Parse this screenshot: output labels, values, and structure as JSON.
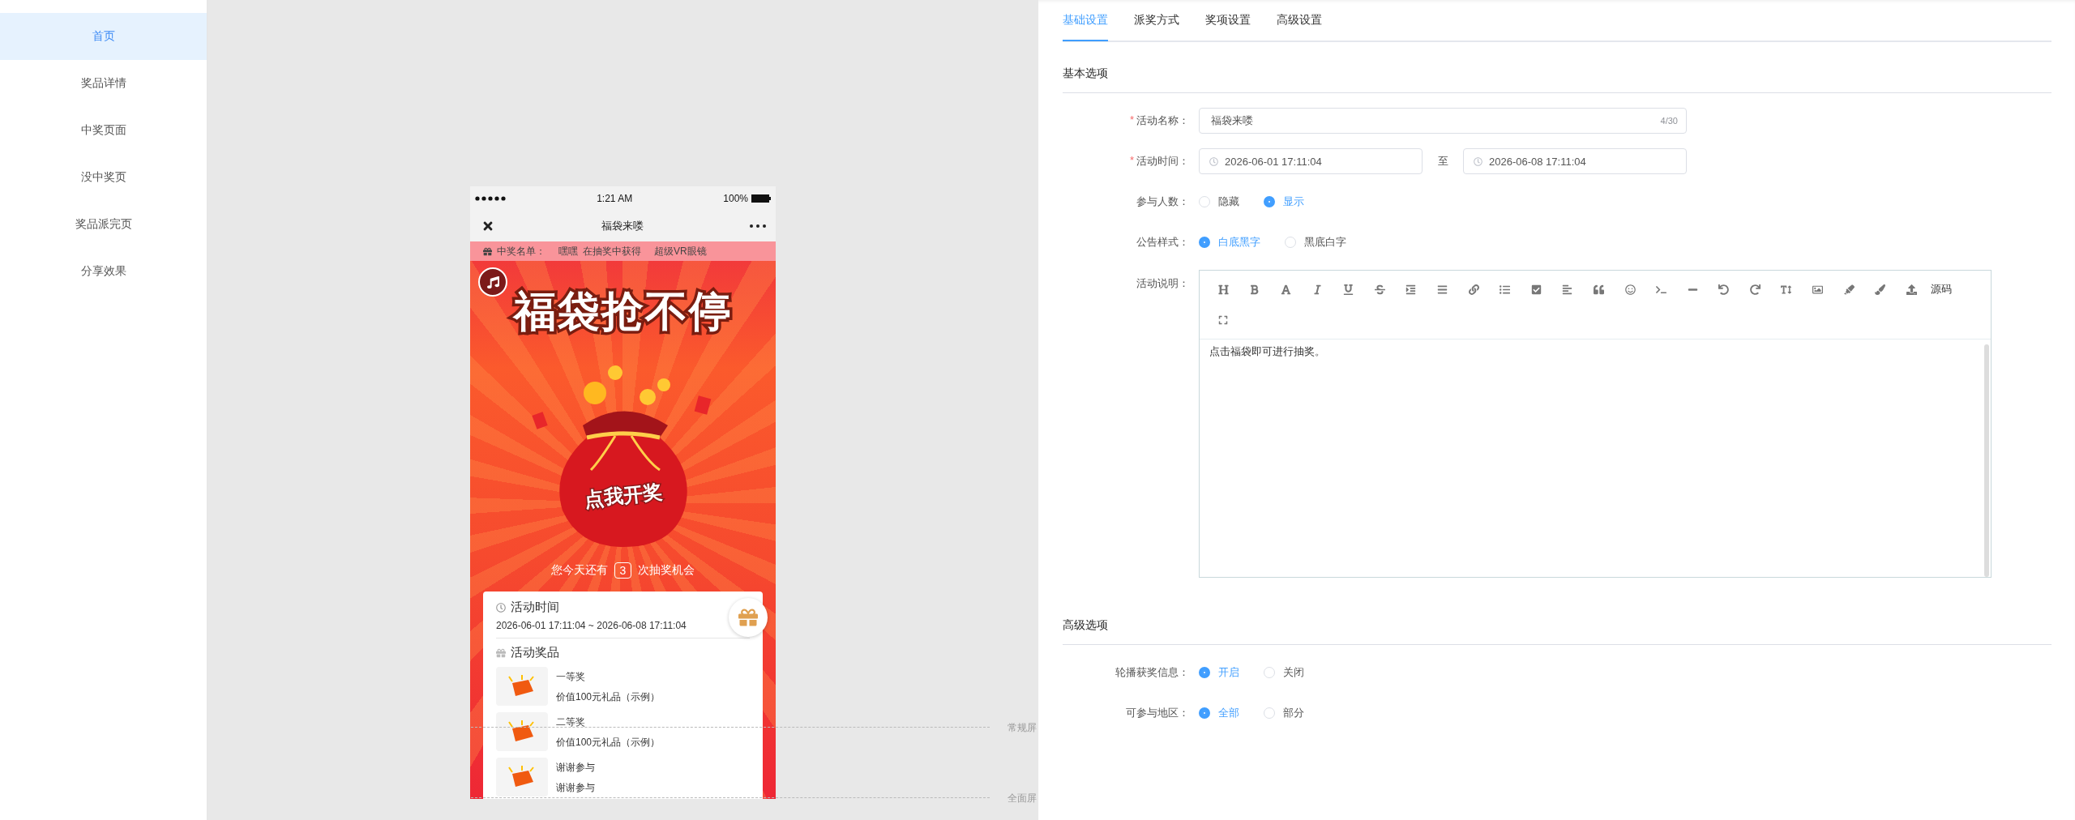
{
  "sidebar": {
    "items": [
      {
        "label": "首页",
        "selected": true
      },
      {
        "label": "奖品详情",
        "selected": false
      },
      {
        "label": "中奖页面",
        "selected": false
      },
      {
        "label": "没中奖页",
        "selected": false
      },
      {
        "label": "奖品派完页",
        "selected": false
      },
      {
        "label": "分享效果",
        "selected": false
      }
    ]
  },
  "phone": {
    "status_bar": {
      "time": "1:21 AM",
      "battery": "100%"
    },
    "nav_title": "福袋来喽",
    "marquee": {
      "label": "中奖名单：",
      "winner": "嘿嘿",
      "action": "在抽奖中获得",
      "prize": "超级VR眼镜"
    },
    "banner_title": "福袋抢不停",
    "bag_label": "点我开奖",
    "chances": {
      "before": "您今天还有",
      "count": "3",
      "after": "次抽奖机会"
    },
    "card": {
      "time_heading": "活动时间",
      "time_range": "2026-06-01 17:11:04 ~ 2026-06-08 17:11:04",
      "prizes_heading": "活动奖品",
      "prizes": [
        {
          "name": "一等奖",
          "desc": "价值100元礼品（示例）"
        },
        {
          "name": "二等奖",
          "desc": "价值100元礼品（示例）"
        },
        {
          "name": "谢谢参与",
          "desc": "谢谢参与"
        }
      ]
    }
  },
  "guides": [
    {
      "label": "常规屏"
    },
    {
      "label": "全面屏"
    }
  ],
  "tabs": [
    {
      "label": "基础设置",
      "selected": true
    },
    {
      "label": "派奖方式",
      "selected": false
    },
    {
      "label": "奖项设置",
      "selected": false
    },
    {
      "label": "高级设置",
      "selected": false
    }
  ],
  "sections": [
    {
      "title": "基本选项",
      "fields": [
        {
          "kind": "text",
          "required_mark": "*",
          "label": "活动名称：",
          "value": "福袋来喽",
          "counter": "4/30"
        },
        {
          "kind": "daterange",
          "required_mark": "*",
          "label": "活动时间：",
          "start": "2026-06-01 17:11:04",
          "separator": "至",
          "end": "2026-06-08 17:11:04"
        },
        {
          "kind": "radio",
          "label": "参与人数：",
          "options": [
            {
              "label": "隐藏",
              "selected": false
            },
            {
              "label": "显示",
              "selected": true
            }
          ]
        },
        {
          "kind": "radio",
          "label": "公告样式：",
          "options": [
            {
              "label": "白底黑字",
              "selected": true
            },
            {
              "label": "黑底白字",
              "selected": false
            }
          ]
        },
        {
          "kind": "editor",
          "label": "活动说明：",
          "source_button": "源码",
          "value": "点击福袋即可进行抽奖。"
        }
      ]
    },
    {
      "title": "高级选项",
      "fields": [
        {
          "kind": "radio",
          "label": "轮播获奖信息：",
          "options": [
            {
              "label": "开启",
              "selected": true
            },
            {
              "label": "关闭",
              "selected": false
            }
          ]
        },
        {
          "kind": "radio",
          "label": "可参与地区：",
          "options": [
            {
              "label": "全部",
              "selected": true
            },
            {
              "label": "部分",
              "selected": false
            }
          ]
        }
      ]
    }
  ]
}
